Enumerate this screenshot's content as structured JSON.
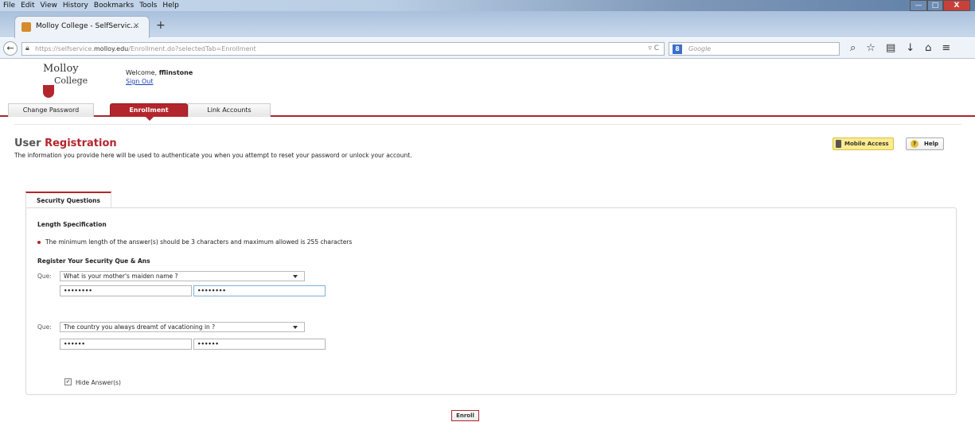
{
  "browser": {
    "menu": [
      "File",
      "Edit",
      "View",
      "History",
      "Bookmarks",
      "Tools",
      "Help"
    ],
    "window_buttons": {
      "min": "—",
      "max": "□",
      "close": "X"
    },
    "tab_title": "Molloy College - SelfServic...",
    "tab_close": "×",
    "new_tab": "+",
    "url_prefix": "https://selfservice.",
    "url_domain": "molloy.edu",
    "url_path": "/Enrollment.do?selectedTab=Enrollment",
    "url_controls": "▿ C",
    "search_engine": "8",
    "search_placeholder": "Google"
  },
  "header": {
    "logo_line1": "Molloy",
    "logo_line2": "College",
    "welcome_prefix": "Welcome, ",
    "username": "fflinstone",
    "sign_out": "Sign Out"
  },
  "app_tabs": [
    {
      "label": "Change Password",
      "active": false
    },
    {
      "label": "Enrollment",
      "active": true
    },
    {
      "label": "Link Accounts",
      "active": false
    }
  ],
  "page": {
    "title_part1": "User ",
    "title_part2": "Registration",
    "intro": "The information you provide here will be used to authenticate you when you attempt to reset your password or unlock your account.",
    "mobile_access": "Mobile Access",
    "help": "Help",
    "help_icon": "?"
  },
  "security": {
    "tab_label": "Security Questions",
    "length_heading": "Length Specification",
    "length_rule": "The minimum length of the answer(s) should be 3 characters and maximum allowed is 255 characters",
    "register_heading": "Register Your Security Que & Ans",
    "que_label": "Que:",
    "questions": [
      {
        "question": "What is your mother's maiden name ?",
        "answer": "••••••••",
        "confirm": "••••••••"
      },
      {
        "question": "The country you always dreamt of vacationing in ?",
        "answer": "••••••",
        "confirm": "••••••"
      }
    ],
    "hide_answers_label": "Hide Answer(s)",
    "hide_answers_checked": true
  },
  "enroll_button": "Enroll",
  "colors": {
    "brand_red": "#b3252c",
    "mobile_yellow": "#fdeb8f",
    "link_blue": "#1a3fb5"
  }
}
